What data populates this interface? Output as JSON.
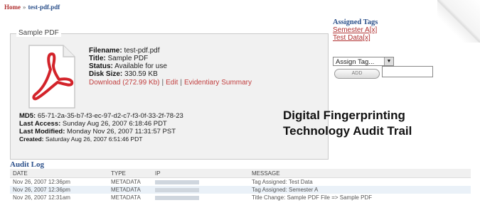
{
  "breadcrumb": {
    "home": "Home",
    "separator": "»",
    "current": "test-pdf.pdf"
  },
  "file_panel": {
    "legend": "Sample PDF",
    "icon": "pdf-icon",
    "filename_label": "Filename:",
    "filename": "test-pdf.pdf",
    "title_label": "Title:",
    "title": "Sample PDF",
    "status_label": "Status:",
    "status": "Available for use",
    "disk_label": "Disk Size:",
    "disk_size": "330.59 KB",
    "download": "Download (272.99 Kb)",
    "edit": "Edit",
    "summary": "Evidentiary Summary",
    "md5_label": "MD5:",
    "md5": "65-71-2a-35-b7-f3-ec-97-d2-c7-f3-0f-33-2f-78-23",
    "last_access_label": "Last Access:",
    "last_access": "Sunday Aug 26, 2007 6:18:46 PDT",
    "last_modified_label": "Last Modified:",
    "last_modified": "Monday Nov 26, 2007 11:31:57 PST",
    "created_label": "Created:",
    "created": "Saturday Aug 26, 2007 6:51:46 PDT"
  },
  "tags": {
    "heading": "Assigned Tags",
    "items": [
      "Semester A[x]",
      "Test Data[x]"
    ],
    "select_value": "Assign Tag...",
    "button_label": "ADD"
  },
  "overlay": {
    "line1": "Digital Fingerprinting",
    "line2": "Technology Audit Trail"
  },
  "audit": {
    "title": "Audit Log",
    "columns": [
      "DATE",
      "TYPE",
      "IP",
      "MESSAGE"
    ],
    "rows": [
      {
        "date": "Nov 26, 2007 12:36pm",
        "type": "METADATA",
        "ip": "",
        "message": "Tag Assigned: Test Data"
      },
      {
        "date": "Nov 26, 2007 12:36pm",
        "type": "METADATA",
        "ip": "",
        "message": "Tag Assigned: Semester A"
      },
      {
        "date": "Nov 26, 2007 12:31am",
        "type": "METADATA",
        "ip": "",
        "message": "Title Change: Sample PDF File => Sample PDF"
      }
    ]
  }
}
